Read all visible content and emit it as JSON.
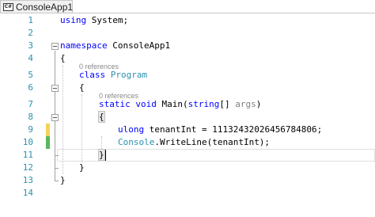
{
  "tab": {
    "icon": "csharp-file-icon",
    "icon_text": "C#",
    "title": "ConsoleApp1"
  },
  "gutter": [
    "1",
    "2",
    "3",
    "4",
    "5",
    "6",
    "7",
    "8",
    "9",
    "10",
    "11",
    "12",
    "13",
    "14"
  ],
  "codelens": {
    "program_refs": "0 references",
    "main_refs": "0 references"
  },
  "code": {
    "l1_using": "using",
    "l1_rest": " System;",
    "l3_kw": "namespace",
    "l3_rest": " ConsoleApp1",
    "l4": "{",
    "l5_kw": "class",
    "l5_type": "Program",
    "l6": "{",
    "l7_kw1": "static",
    "l7_kw2": "void",
    "l7_name": "Main(",
    "l7_type": "string",
    "l7_mid": "[] ",
    "l7_arg": "args",
    "l7_end": ")",
    "l8": "{",
    "l9_kw": "ulong",
    "l9_rest": " tenantInt = 11132432026456784806;",
    "l10_type": "Console",
    "l10_rest": ".WriteLine(tenantInt);",
    "l11": "}",
    "l12": "}",
    "l13": "}"
  },
  "colors": {
    "keyword": "#0000ff",
    "type": "#2b91af",
    "line_number": "#2b91af",
    "changed_unsaved": "#f0d45a",
    "changed_saved": "#5cb85c"
  }
}
